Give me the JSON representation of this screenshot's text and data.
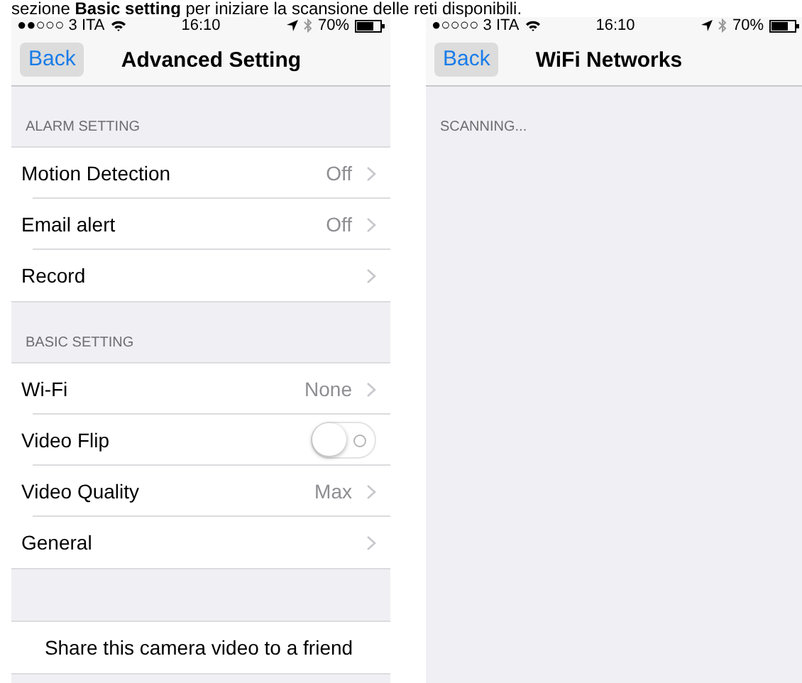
{
  "caption": "sezione **Basic setting** per iniziare la scansione delle reti disponibili.",
  "screens": [
    {
      "status_bar": {
        "carrier": "●●○○○ 3 ITA",
        "time": "16:10",
        "battery": "70%"
      },
      "nav": {
        "back": "Back",
        "title": "Advanced Setting"
      },
      "sections": [
        {
          "title": "ALARM SETTING",
          "rows": [
            {
              "kind": "detail",
              "label": "Motion Detection",
              "value": "Off"
            },
            {
              "kind": "detail",
              "label": "Email alert",
              "value": "Off"
            },
            {
              "kind": "detail",
              "label": "Record"
            }
          ]
        },
        {
          "title": "BASIC SETTING",
          "rows": [
            {
              "kind": "detail",
              "label": "Wi-Fi",
              "value": "None"
            },
            {
              "kind": "toggle",
              "label": "Video Flip",
              "on": false
            },
            {
              "kind": "detail",
              "label": "Video Quality",
              "value": "Max"
            },
            {
              "kind": "detail",
              "label": "General"
            }
          ]
        },
        {
          "rows": [
            {
              "kind": "action",
              "label": "Share this camera video to a friend"
            }
          ]
        }
      ]
    },
    {
      "status_bar": {
        "carrier": "●○○○○ 3 ITA",
        "time": "16:10",
        "battery": "70%"
      },
      "nav": {
        "back": "Back",
        "title": "WiFi Networks"
      },
      "sections": [
        {
          "title": "SCANNING..."
        }
      ]
    }
  ]
}
